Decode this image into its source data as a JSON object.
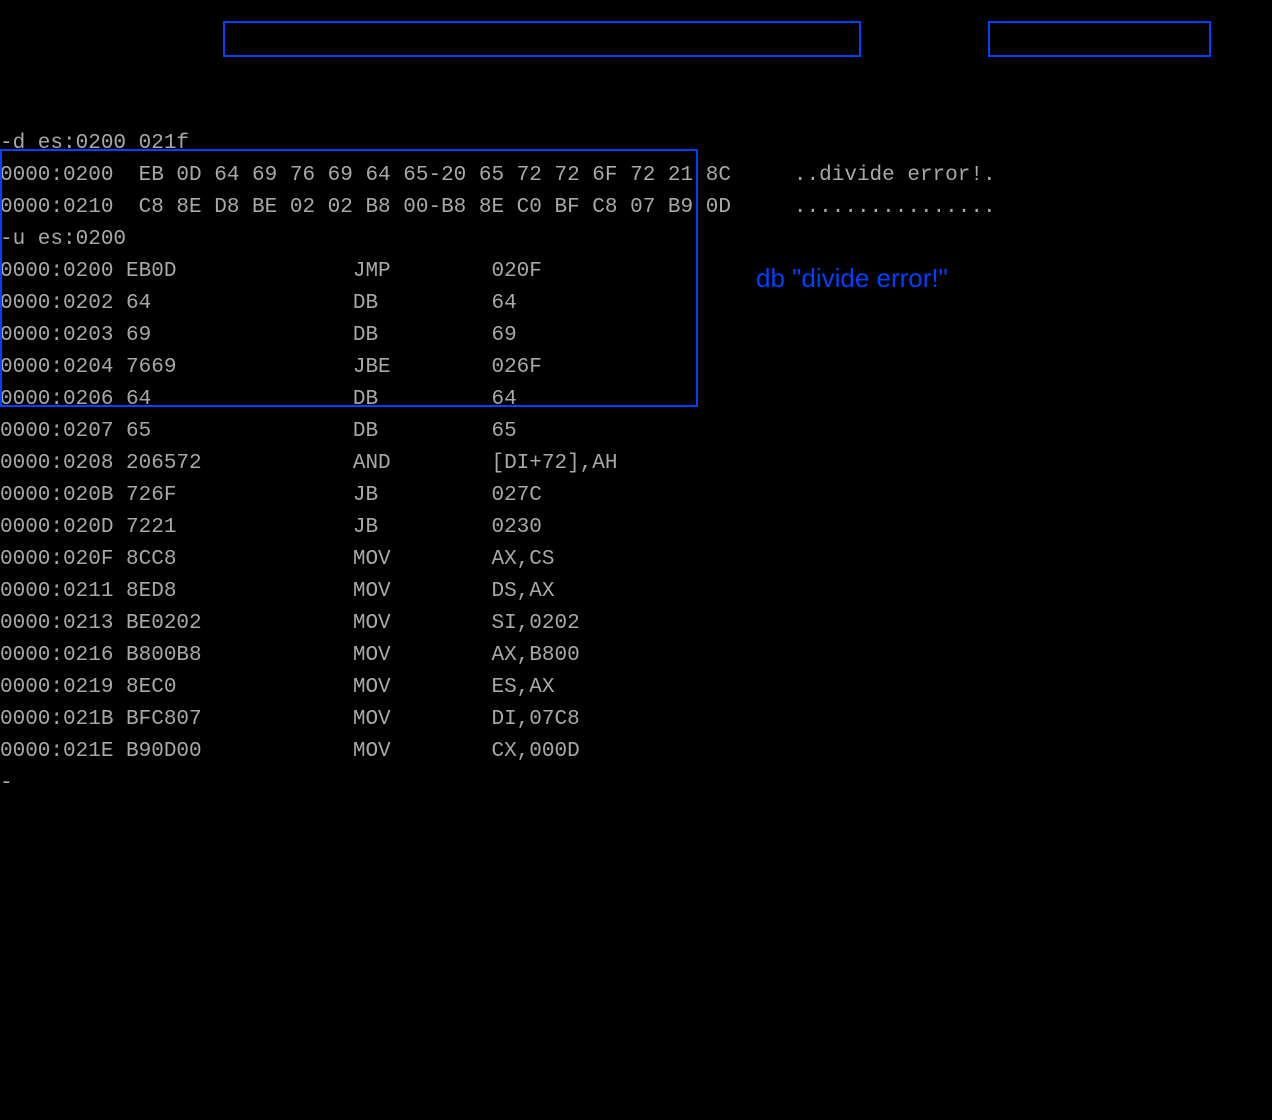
{
  "dump": {
    "cmd": "-d es:0200 021f",
    "lines": [
      {
        "addr": "0000:0200",
        "hex": "EB 0D 64 69 76 69 64 65-20 65 72 72 6F 72 21 8C",
        "ascii": "..divide error!."
      },
      {
        "addr": "0000:0210",
        "hex": "C8 8E D8 BE 02 02 B8 00-B8 8E C0 BF C8 07 B9 0D",
        "ascii": "................"
      }
    ]
  },
  "unasm": {
    "cmd": "-u es:0200",
    "rows": [
      {
        "addr": "0000:0200",
        "bytes": "EB0D",
        "mnem": "JMP",
        "op": "020F"
      },
      {
        "addr": "0000:0202",
        "bytes": "64",
        "mnem": "DB",
        "op": "64"
      },
      {
        "addr": "0000:0203",
        "bytes": "69",
        "mnem": "DB",
        "op": "69"
      },
      {
        "addr": "0000:0204",
        "bytes": "7669",
        "mnem": "JBE",
        "op": "026F"
      },
      {
        "addr": "0000:0206",
        "bytes": "64",
        "mnem": "DB",
        "op": "64"
      },
      {
        "addr": "0000:0207",
        "bytes": "65",
        "mnem": "DB",
        "op": "65"
      },
      {
        "addr": "0000:0208",
        "bytes": "206572",
        "mnem": "AND",
        "op": "[DI+72],AH"
      },
      {
        "addr": "0000:020B",
        "bytes": "726F",
        "mnem": "JB",
        "op": "027C"
      },
      {
        "addr": "0000:020D",
        "bytes": "7221",
        "mnem": "JB",
        "op": "0230"
      },
      {
        "addr": "0000:020F",
        "bytes": "8CC8",
        "mnem": "MOV",
        "op": "AX,CS"
      },
      {
        "addr": "0000:0211",
        "bytes": "8ED8",
        "mnem": "MOV",
        "op": "DS,AX"
      },
      {
        "addr": "0000:0213",
        "bytes": "BE0202",
        "mnem": "MOV",
        "op": "SI,0202"
      },
      {
        "addr": "0000:0216",
        "bytes": "B800B8",
        "mnem": "MOV",
        "op": "AX,B800"
      },
      {
        "addr": "0000:0219",
        "bytes": "8EC0",
        "mnem": "MOV",
        "op": "ES,AX"
      },
      {
        "addr": "0000:021B",
        "bytes": "BFC807",
        "mnem": "MOV",
        "op": "DI,07C8"
      },
      {
        "addr": "0000:021E",
        "bytes": "B90D00",
        "mnem": "MOV",
        "op": "CX,000D"
      }
    ]
  },
  "annotation": "db \"divide error!\"",
  "prompt": "-"
}
